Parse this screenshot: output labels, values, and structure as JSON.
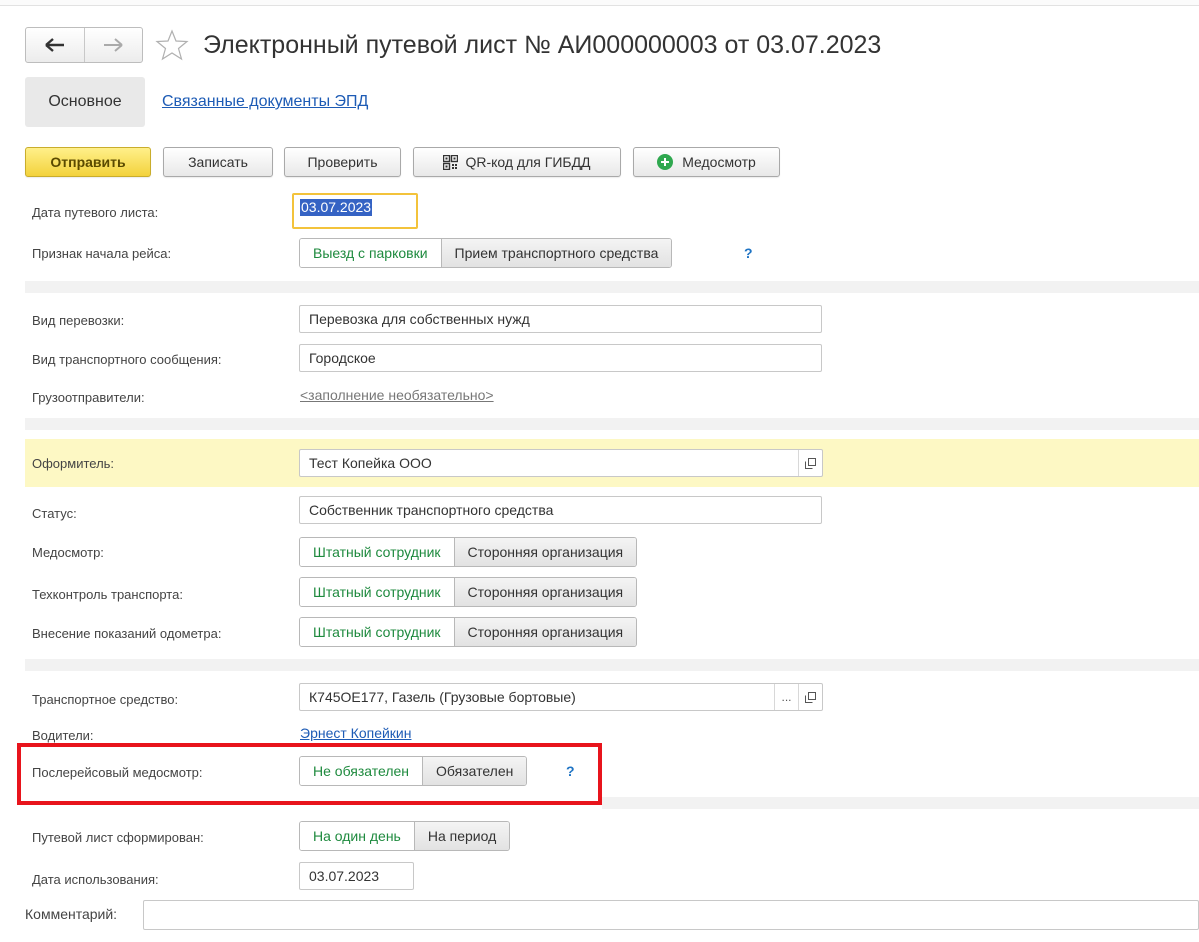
{
  "window": {
    "title": "Электронный путевой лист № АИ000000003 от 03.07.2023"
  },
  "tabs": {
    "main": "Основное",
    "related": "Связанные документы ЭПД"
  },
  "toolbar": {
    "send": "Отправить",
    "save": "Записать",
    "check": "Проверить",
    "qr": "QR-код для ГИБДД",
    "medical": "Медосмотр"
  },
  "form": {
    "date": {
      "label": "Дата путевого листа:",
      "value": "03.07.2023"
    },
    "trip_start": {
      "label": "Признак начала рейса:",
      "options": [
        "Выезд с парковки",
        "Прием транспортного средства"
      ],
      "selected": "Выезд с парковки",
      "help": "?"
    },
    "transport_kind": {
      "label": "Вид перевозки:",
      "value": "Перевозка для собственных нужд"
    },
    "transport_msg": {
      "label": "Вид транспортного сообщения:",
      "value": "Городское"
    },
    "shippers": {
      "label": "Грузоотправители:",
      "value": "<заполнение необязательно>"
    },
    "issuer": {
      "label": "Оформитель:",
      "value": "Тест Копейка ООО"
    },
    "status": {
      "label": "Статус:",
      "value": "Собственник транспортного средства"
    },
    "medical_check": {
      "label": "Медосмотр:",
      "options": [
        "Штатный сотрудник",
        "Сторонняя организация"
      ],
      "selected": "Штатный сотрудник"
    },
    "tech_control": {
      "label": "Техконтроль транспорта:",
      "options": [
        "Штатный сотрудник",
        "Сторонняя организация"
      ],
      "selected": "Штатный сотрудник"
    },
    "odometer": {
      "label": "Внесение показаний одометра:",
      "options": [
        "Штатный сотрудник",
        "Сторонняя организация"
      ],
      "selected": "Штатный сотрудник"
    },
    "vehicle": {
      "label": "Транспортное средство:",
      "value": "К745ОЕ177, Газель  (Грузовые бортовые)",
      "select_button": "..."
    },
    "drivers": {
      "label": "Водители:",
      "value": "Эрнест Копейкин"
    },
    "post_trip_medical": {
      "label": "Послерейсовый медосмотр:",
      "options": [
        "Не обязателен",
        "Обязателен"
      ],
      "selected": "Не обязателен",
      "help": "?"
    },
    "formed_for": {
      "label": "Путевой лист сформирован:",
      "options": [
        "На один день",
        "На период"
      ],
      "selected": "На один день"
    },
    "usage_date": {
      "label": "Дата использования:",
      "value": "03.07.2023"
    },
    "comment": {
      "label": "Комментарий:",
      "value": ""
    }
  },
  "colors": {
    "highlight_row": "#fdf8c4",
    "selected_option": "#1e8a3e",
    "link": "#1d5bb5",
    "annotation_box": "#e8141c",
    "primary_button": "#f3d23c"
  }
}
